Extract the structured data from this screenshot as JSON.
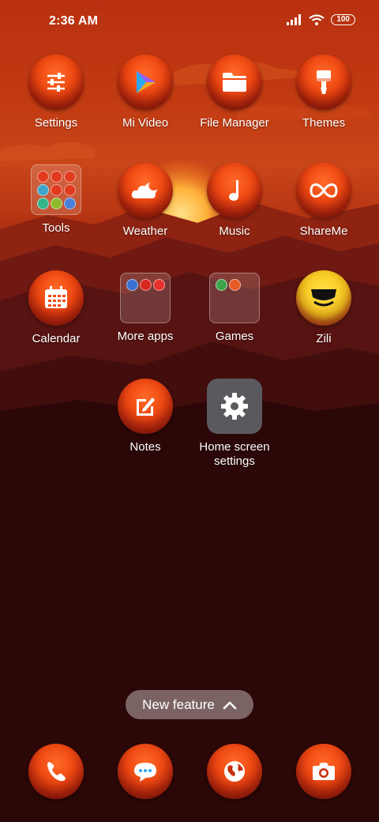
{
  "status_bar": {
    "time": "2:36 AM",
    "battery": "100"
  },
  "apps": {
    "row1": [
      {
        "label": "Settings",
        "icon": "sliders-icon"
      },
      {
        "label": "Mi Video",
        "icon": "play-icon"
      },
      {
        "label": "File Manager",
        "icon": "folder-icon"
      },
      {
        "label": "Themes",
        "icon": "brush-icon"
      }
    ],
    "row2": [
      {
        "label": "Tools",
        "icon": "folder-tools-icon"
      },
      {
        "label": "Weather",
        "icon": "cloud-moon-icon"
      },
      {
        "label": "Music",
        "icon": "music-note-icon"
      },
      {
        "label": "ShareMe",
        "icon": "infinity-icon"
      }
    ],
    "row3": [
      {
        "label": "Calendar",
        "icon": "calendar-icon"
      },
      {
        "label": "More apps",
        "icon": "folder-icon"
      },
      {
        "label": "Games",
        "icon": "folder-icon"
      },
      {
        "label": "Zili",
        "icon": "zili-logo-icon"
      }
    ],
    "row4": [
      {
        "label": "Notes",
        "icon": "edit-note-icon"
      },
      {
        "label": "Home screen settings",
        "icon": "gear-icon"
      }
    ]
  },
  "new_feature": {
    "label": "New feature",
    "icon": "chevron-up-icon"
  },
  "dock": [
    {
      "icon": "phone-icon"
    },
    {
      "icon": "message-icon"
    },
    {
      "icon": "browser-globe-icon"
    },
    {
      "icon": "camera-icon"
    }
  ],
  "colors": {
    "accent": "#f04a13",
    "sky_top": "#b8300f",
    "bottom": "#220506"
  }
}
